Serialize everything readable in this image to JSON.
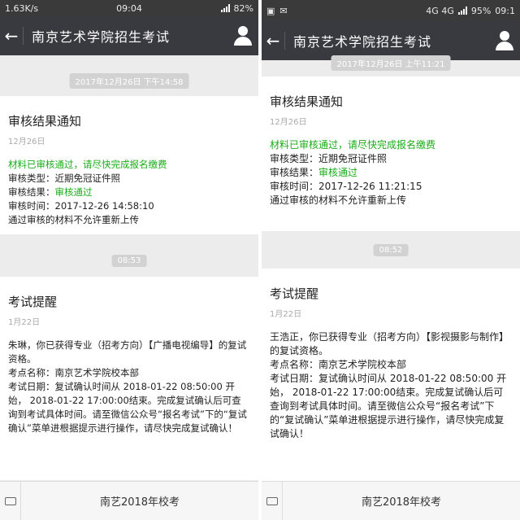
{
  "left": {
    "status": {
      "speed": "1.63K/s",
      "time": "09:04",
      "battery": "82%"
    },
    "title": "南京艺术学院招生考试",
    "msg1": {
      "timestamp": "2017年12月26日 下午14:58",
      "title": "审核结果通知",
      "date": "12月26日",
      "line1": "材料已审核通过，请尽快完成报名缴费",
      "line2": "审核类型：近期免冠证件照",
      "line3_label": "审核结果：",
      "line3_value": "审核通过",
      "line4": "审核时间：2017-12-26 14:58:10",
      "line5": "通过审核的材料不允许重新上传"
    },
    "msg2": {
      "timestamp": "08:53",
      "title": "考试提醒",
      "date": "1月22日",
      "line1": "朱琳，你已获得专业（招考方向）【广播电视编导】的复试资格。",
      "line2": "考点名称：南京艺术学院校本部",
      "line3": "考试日期：复试确认时间从 2018-01-22 08:50:00 开始， 2018-01-22 17:00:00结束。完成复试确认后可查询到考试具体时间。请至微信公众号“报名考试”下的“复试确认”菜单进根据提示进行操作，请尽快完成复试确认！"
    },
    "menu": "南艺2018年校考"
  },
  "right": {
    "status": {
      "network": "4G 4G",
      "battery": "95%",
      "time": "09:1"
    },
    "title": "南京艺术学院招生考试",
    "msg1": {
      "timestamp": "2017年12月26日 上午11:21",
      "title": "审核结果通知",
      "date": "12月26日",
      "line1": "材料已审核通过，请尽快完成报名缴费",
      "line2": "审核类型：近期免冠证件照",
      "line3_label": "审核结果：",
      "line3_value": "审核通过",
      "line4": "审核时间：2017-12-26 11:21:15",
      "line5": "通过审核的材料不允许重新上传"
    },
    "msg2": {
      "timestamp": "08:52",
      "title": "考试提醒",
      "date": "1月22日",
      "line1": "王浩正，你已获得专业（招考方向）【影视摄影与制作】的复试资格。",
      "line2": "考点名称：南京艺术学院校本部",
      "line3": "考试日期：复试确认时间从 2018-01-22 08:50:00 开始， 2018-01-22 17:00:00结束。完成复试确认后可查询到考试具体时间。请至微信公众号“报名考试”下的“复试确认”菜单进根据提示进行操作，请尽快完成复试确认！"
    },
    "menu": "南艺2018年校考"
  }
}
